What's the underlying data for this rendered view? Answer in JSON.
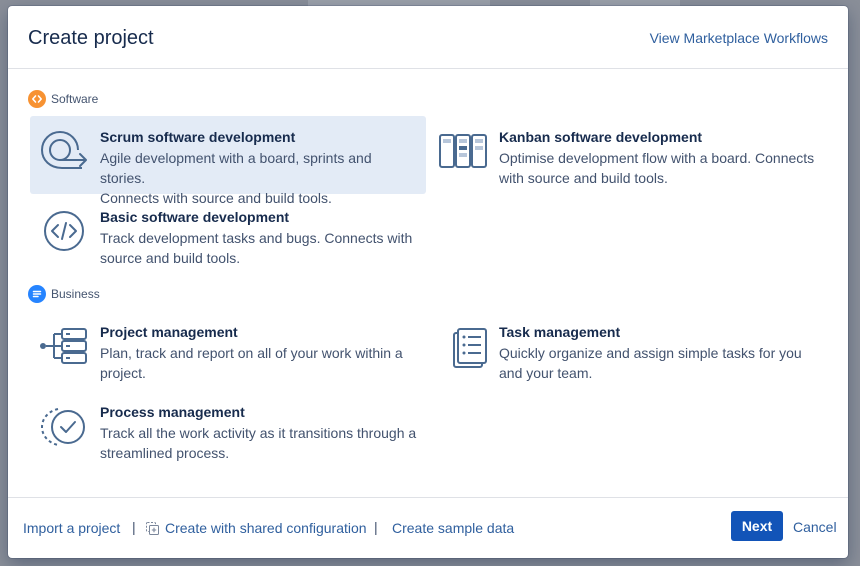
{
  "dialog": {
    "title": "Create project",
    "marketplace_link": "View Marketplace Workflows"
  },
  "sections": [
    {
      "heading": "Software",
      "icon": "code-icon",
      "color": "#f79232",
      "options": [
        {
          "title": "Scrum software development",
          "desc_line1": "Agile development with a board, sprints and stories.",
          "desc_line2": "Connects with source and build tools.",
          "icon": "scrum-cycle-icon",
          "selected": true
        },
        {
          "title": "Kanban software development",
          "desc_line1": "Optimise development flow with a board. Connects",
          "desc_line2": "with source and build tools.",
          "icon": "kanban-board-icon",
          "selected": false
        },
        {
          "title": "Basic software development",
          "desc_line1": "Track development tasks and bugs. Connects with",
          "desc_line2": "source and build tools.",
          "icon": "code-brackets-icon",
          "selected": false
        }
      ]
    },
    {
      "heading": "Business",
      "icon": "list-icon",
      "color": "#2684ff",
      "options": [
        {
          "title": "Project management",
          "desc_line1": "Plan, track and report on all of your work within a",
          "desc_line2": "project.",
          "icon": "project-tree-icon",
          "selected": false
        },
        {
          "title": "Task management",
          "desc_line1": "Quickly organize and assign simple tasks for you",
          "desc_line2": "and your team.",
          "icon": "checklist-icon",
          "selected": false
        },
        {
          "title": "Process management",
          "desc_line1": "Track all the work activity as it transitions through a",
          "desc_line2": "streamlined process.",
          "icon": "process-check-icon",
          "selected": false
        }
      ]
    }
  ],
  "footer": {
    "import_link": "Import a project",
    "shared_config_link": "Create with shared configuration",
    "sample_data_link": "Create sample data",
    "separator": "|",
    "next_label": "Next",
    "cancel_label": "Cancel"
  },
  "colors": {
    "primary": "#1254b8",
    "link": "#2f5f9e",
    "selected_bg": "#e3ebf6",
    "icon_stroke": "#4a6a90"
  }
}
